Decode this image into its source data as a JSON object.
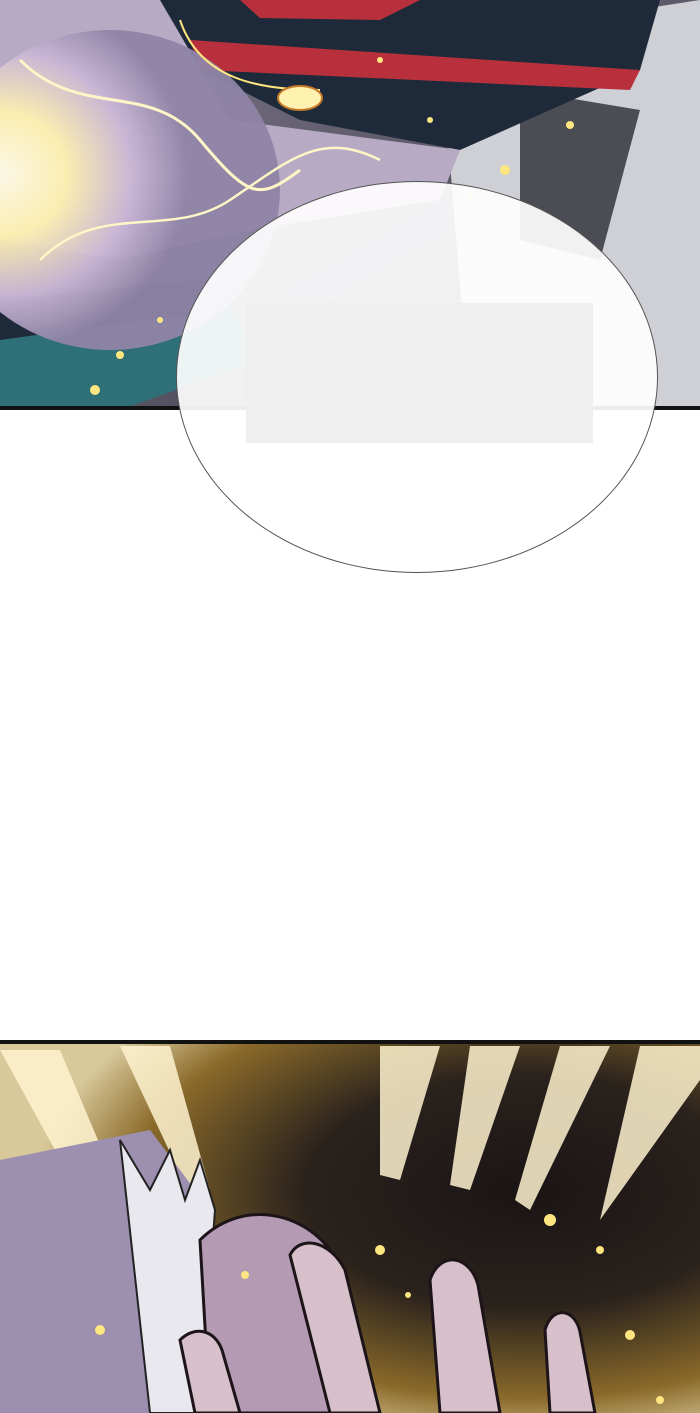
{
  "comic": {
    "speech_bubble": {
      "text": ""
    },
    "colors": {
      "energy_glow": "#fff6c8",
      "spark": "#ffe680",
      "cloth_red": "#b8303c",
      "cloth_dark": "#1e2a3a",
      "teal_trim": "#2f6f78",
      "skin_lavender": "#b7aac4",
      "dark_bg": "#1a1416",
      "gold_burst": "#e8c25a"
    }
  }
}
